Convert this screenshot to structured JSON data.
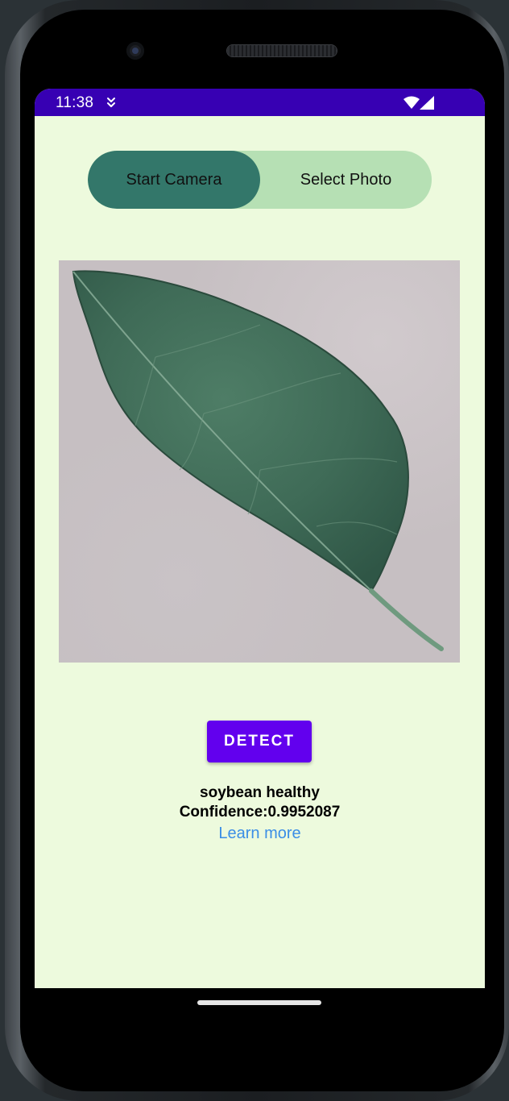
{
  "status_bar": {
    "time": "11:38",
    "notification_icon": "download-arrow-icon",
    "wifi_icon": "wifi-icon",
    "signal_icon": "cell-signal-icon"
  },
  "toggle": {
    "start_camera_label": "Start Camera",
    "select_photo_label": "Select Photo",
    "selected": "Start Camera"
  },
  "photo": {
    "alt": "soybean leaf"
  },
  "detect_label": "DETECT",
  "result": {
    "name": "soybean healthy",
    "confidence": "Confidence:0.9952087",
    "learn_more": "Learn more"
  },
  "colors": {
    "screen_bg": "#edfadd",
    "status_bar": "#3700b3",
    "toggle_selected": "#33776a",
    "toggle_bg": "#b6e0b4",
    "detect_button": "#6200ee",
    "link": "#3b8ee6"
  }
}
